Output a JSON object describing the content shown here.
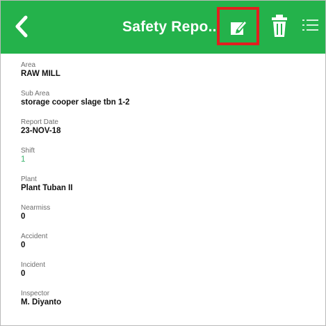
{
  "header": {
    "title": "Safety Repo..",
    "background_color": "#24b24b",
    "back_icon": "chevron-left-icon",
    "edit_icon": "edit-icon",
    "delete_icon": "trash-icon",
    "menu_icon": "list-icon",
    "highlight_color": "#e21f1f"
  },
  "fields": {
    "area": {
      "label": "Area",
      "value": "RAW MILL"
    },
    "sub_area": {
      "label": "Sub Area",
      "value": "storage cooper slage tbn 1-2"
    },
    "report_date": {
      "label": "Report Date",
      "value": "23-NOV-18"
    },
    "shift": {
      "label": "Shift",
      "value": "1",
      "value_color": "#39b36b"
    },
    "plant": {
      "label": "Plant",
      "value": "Plant Tuban II"
    },
    "nearmiss": {
      "label": "Nearmiss",
      "value": "0"
    },
    "accident": {
      "label": "Accident",
      "value": "0"
    },
    "incident": {
      "label": "Incident",
      "value": "0"
    },
    "inspector": {
      "label": "Inspector",
      "value": "M. Diyanto"
    }
  }
}
